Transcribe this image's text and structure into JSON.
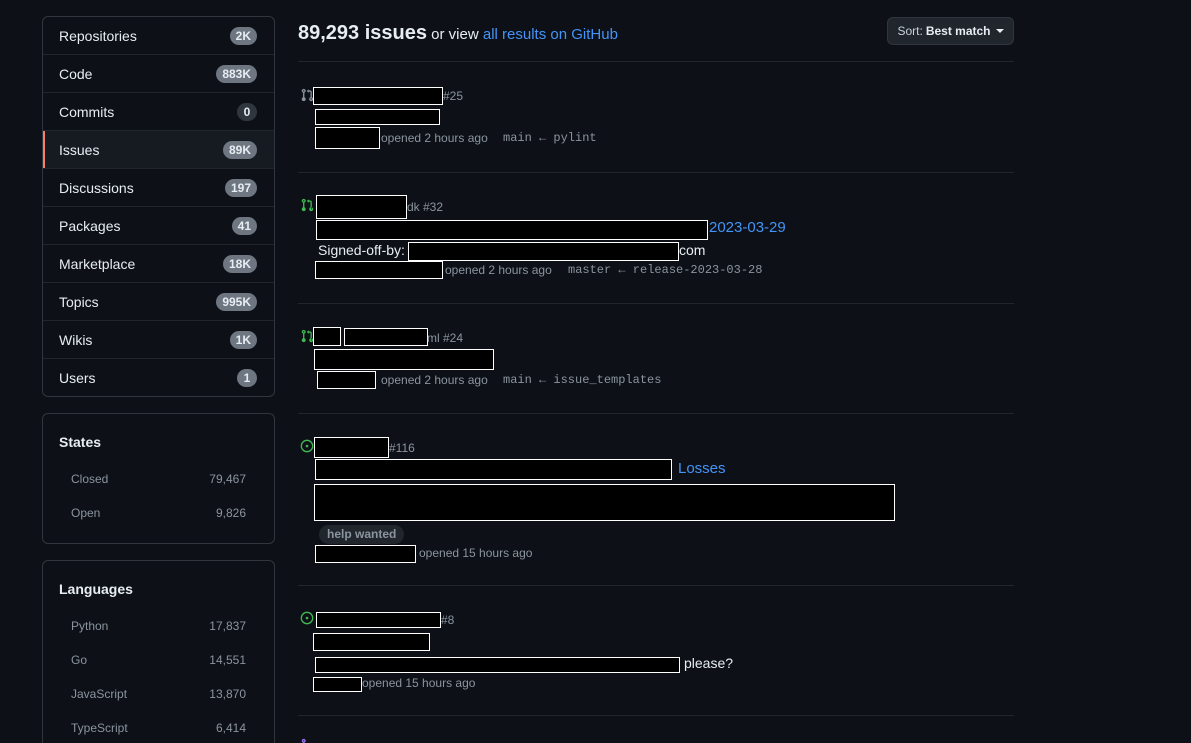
{
  "sidebar": {
    "nav": [
      {
        "label": "Repositories",
        "count": "2K"
      },
      {
        "label": "Code",
        "count": "883K"
      },
      {
        "label": "Commits",
        "count": "0"
      },
      {
        "label": "Issues",
        "count": "89K"
      },
      {
        "label": "Discussions",
        "count": "197"
      },
      {
        "label": "Packages",
        "count": "41"
      },
      {
        "label": "Marketplace",
        "count": "18K"
      },
      {
        "label": "Topics",
        "count": "995K"
      },
      {
        "label": "Wikis",
        "count": "1K"
      },
      {
        "label": "Users",
        "count": "1"
      }
    ],
    "states": {
      "title": "States",
      "items": [
        {
          "label": "Closed",
          "count": "79,467"
        },
        {
          "label": "Open",
          "count": "9,826"
        }
      ]
    },
    "languages": {
      "title": "Languages",
      "items": [
        {
          "label": "Python",
          "count": "17,837"
        },
        {
          "label": "Go",
          "count": "14,551"
        },
        {
          "label": "JavaScript",
          "count": "13,870"
        },
        {
          "label": "TypeScript",
          "count": "6,414"
        }
      ]
    }
  },
  "header": {
    "count": "89,293 issues",
    "or_view": "or view",
    "link": "all results on GitHub",
    "sort_prefix": "Sort:",
    "sort_value": "Best match"
  },
  "results": [
    {
      "number": "#25",
      "meta": "opened 2 hours ago",
      "branch": "main ← pylint",
      "icon": "pull-request-icon"
    },
    {
      "number": "dk #32",
      "link_text": "2023-03-29",
      "body_prefix": "Signed-off-by:",
      "body_suffix": "com",
      "meta": "opened 2 hours ago",
      "branch": "master ← release-2023-03-28",
      "icon": "pull-request-icon"
    },
    {
      "number": "ml #24",
      "meta": "opened 2 hours ago",
      "branch": "main ← issue_templates",
      "icon": "pull-request-icon"
    },
    {
      "number": "#116",
      "link_text": "Losses",
      "label": "help wanted",
      "meta": "opened 15 hours ago",
      "icon": "issue-open-icon"
    },
    {
      "number": "#8",
      "body_suffix": "please?",
      "meta": "opened 15 hours ago",
      "icon": "issue-open-icon"
    }
  ],
  "colors": {
    "background": "#0d1117",
    "accent": "#4493f8",
    "selected_marker": "#f78166",
    "pr_icon": "#3fb950",
    "pr_icon_draft": "#8b949e"
  }
}
